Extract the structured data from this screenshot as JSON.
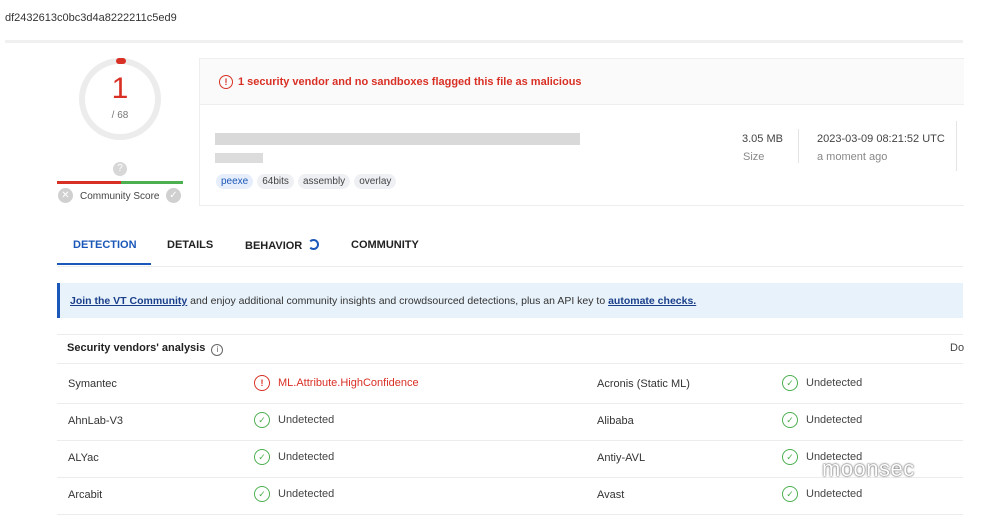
{
  "hash": "df2432613c0bc3d4a8222211c5ed9",
  "score": {
    "detections": "1",
    "total": "/ 68"
  },
  "community": {
    "label": "Community Score",
    "bulb": "?",
    "dislike": "✕",
    "like": "✓"
  },
  "alert": {
    "icon": "!",
    "text": "1 security vendor and no sandboxes flagged this file as malicious"
  },
  "file": {
    "tags": [
      "peexe",
      "64bits",
      "assembly",
      "overlay"
    ],
    "size_value": "3.05 MB",
    "size_label": "Size",
    "date_value": "2023-03-09 08:21:52 UTC",
    "date_label": "a moment ago"
  },
  "tabs": [
    "DETECTION",
    "DETAILS",
    "BEHAVIOR",
    "COMMUNITY"
  ],
  "banner": {
    "link1": "Join the VT Community",
    "middle": " and enjoy additional community insights and crowdsourced detections, plus an API key to ",
    "link2": "automate checks."
  },
  "table": {
    "title": "Security vendors' analysis",
    "info_icon": "i",
    "cut_header": "Do",
    "rows": [
      {
        "v1": "Symantec",
        "r1": "ML.Attribute.HighConfidence",
        "r1_malicious": true,
        "v2": "Acronis (Static ML)",
        "r2": "Undetected"
      },
      {
        "v1": "AhnLab-V3",
        "r1": "Undetected",
        "r1_malicious": false,
        "v2": "Alibaba",
        "r2": "Undetected"
      },
      {
        "v1": "ALYac",
        "r1": "Undetected",
        "r1_malicious": false,
        "v2": "Antiy-AVL",
        "r2": "Undetected"
      },
      {
        "v1": "Arcabit",
        "r1": "Undetected",
        "r1_malicious": false,
        "v2": "Avast",
        "r2": "Undetected"
      }
    ]
  },
  "watermark": "moonsec",
  "colors": {
    "malicious": "#d93025",
    "clean": "#4caf50",
    "accent": "#1a57b8"
  }
}
